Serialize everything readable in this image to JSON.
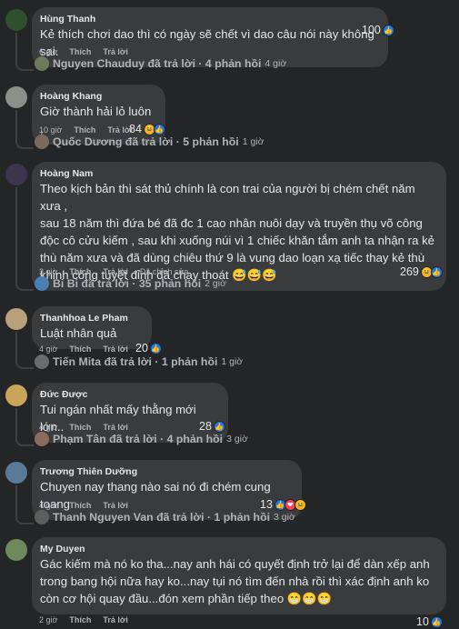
{
  "comments": [
    {
      "author": "Hùng Thanh",
      "lines": [
        "Kẻ thích chơi dao thì có ngày sẽ chết vì dao câu nói này không sai."
      ],
      "time": "6 giờ",
      "like": "Thích",
      "reply": "Trả lời",
      "edited": "",
      "reaction_count": "100",
      "reaction_types": [
        "like"
      ],
      "avatar_color": "#2f4f2f",
      "reply_summary": {
        "text": "Nguyen Chauduy đã trả lời · 4 phản hồi",
        "time": "4 giờ",
        "avatar_color": "#6a7a5a"
      }
    },
    {
      "author": "Hoàng Khang",
      "lines": [
        "Giờ thành hải lỏ luôn ,"
      ],
      "time": "10 giờ",
      "like": "Thích",
      "reply": "Trả lời",
      "edited": "",
      "reaction_count": "84",
      "reaction_types": [
        "haha",
        "like"
      ],
      "avatar_color": "#8a8f8a",
      "reply_summary": {
        "text": "Quốc Dương đã trả lời · 5 phản hồi",
        "time": "1 giờ",
        "avatar_color": "#7a6a5e"
      }
    },
    {
      "author": "Hoàng Nam",
      "lines": [
        "Theo kịch bản thì sát thủ chính là con trai của người bị chém chết năm xưa ,",
        "sau 18 năm thì đứa bé đã đc 1 cao nhân nuôi dạy và truyền thụ võ công",
        "độc cô cửu kiếm , sau khi xuống núi vì 1 chiếc khăn tắm anh ta nhận ra kẻ",
        "thù năm xưa và đã dùng chiêu thứ 9 là vung dao loạn xạ tiếc thay kẻ thù",
        "khinh công tuyệt đỉnh đã chạy thoát 😅😅😅"
      ],
      "time": "3 giờ",
      "like": "Thích",
      "reply": "Trả lời",
      "edited": "Đã chỉnh sửa",
      "reaction_count": "269",
      "reaction_types": [
        "haha",
        "like"
      ],
      "avatar_color": "#3b3550",
      "reply_summary": {
        "text": "Bi Bi đã trả lời · 35 phản hồi",
        "time": "2 giờ",
        "avatar_color": "#4a7fb0"
      }
    },
    {
      "author": "Thanhhoa Le Pham",
      "lines": [
        "Luật nhân quả"
      ],
      "time": "4 giờ",
      "like": "Thích",
      "reply": "Trả lời",
      "edited": "",
      "reaction_count": "20",
      "reaction_types": [
        "like"
      ],
      "avatar_color": "#b9a07a",
      "reply_summary": {
        "text": "Tiến Mita đã trả lời · 1 phản hồi",
        "time": "1 giờ",
        "avatar_color": "#6b6b6b"
      }
    },
    {
      "author": "Đức Được",
      "lines": [
        "Tui ngán nhất mấy thằng mới lớn.."
      ],
      "time": "4 giờ",
      "like": "Thích",
      "reply": "Trả lời",
      "edited": "",
      "reaction_count": "28",
      "reaction_types": [
        "like"
      ],
      "avatar_color": "#c9a55a",
      "reply_summary": {
        "text": "Phạm Tân đã trả lời · 4 phản hồi",
        "time": "3 giờ",
        "avatar_color": "#8a6a5a"
      }
    },
    {
      "author": "Trương Thiên Dưỡng",
      "lines": [
        "Chuyen nay thang nào sai nó đi chém cung toang"
      ],
      "time": "4 giờ",
      "like": "Thích",
      "reply": "Trả lời",
      "edited": "",
      "reaction_count": "13",
      "reaction_types": [
        "like",
        "heart",
        "haha"
      ],
      "avatar_color": "#5a7a9a",
      "reply_summary": {
        "text": "Thanh Nguyen Van đã trả lời · 1 phản hồi",
        "time": "3 giờ",
        "avatar_color": "#5e5e5e"
      }
    },
    {
      "author": "My Duyen",
      "lines": [
        "Gác kiếm mà nó ko tha...nay anh hái có quyết định trở lại để dàn xếp anh",
        "trong bang hội nữa hay ko...nay tụi nó tìm đến nhà rồi thì xác định anh ko",
        "còn cơ hội quay đầu...đón xem phần tiếp theo 😁😁😁"
      ],
      "time": "2 giờ",
      "like": "Thích",
      "reply": "Trả lời",
      "edited": "",
      "reaction_count": "10",
      "reaction_types": [
        "like"
      ],
      "avatar_color": "#6e8a5a",
      "reply_summary": null
    }
  ],
  "colors": {
    "background": "#242526",
    "bubble": "#3a3b3c",
    "text": "#e4e6eb",
    "muted": "#b0b3b8",
    "like_blue": "#1877f2"
  }
}
